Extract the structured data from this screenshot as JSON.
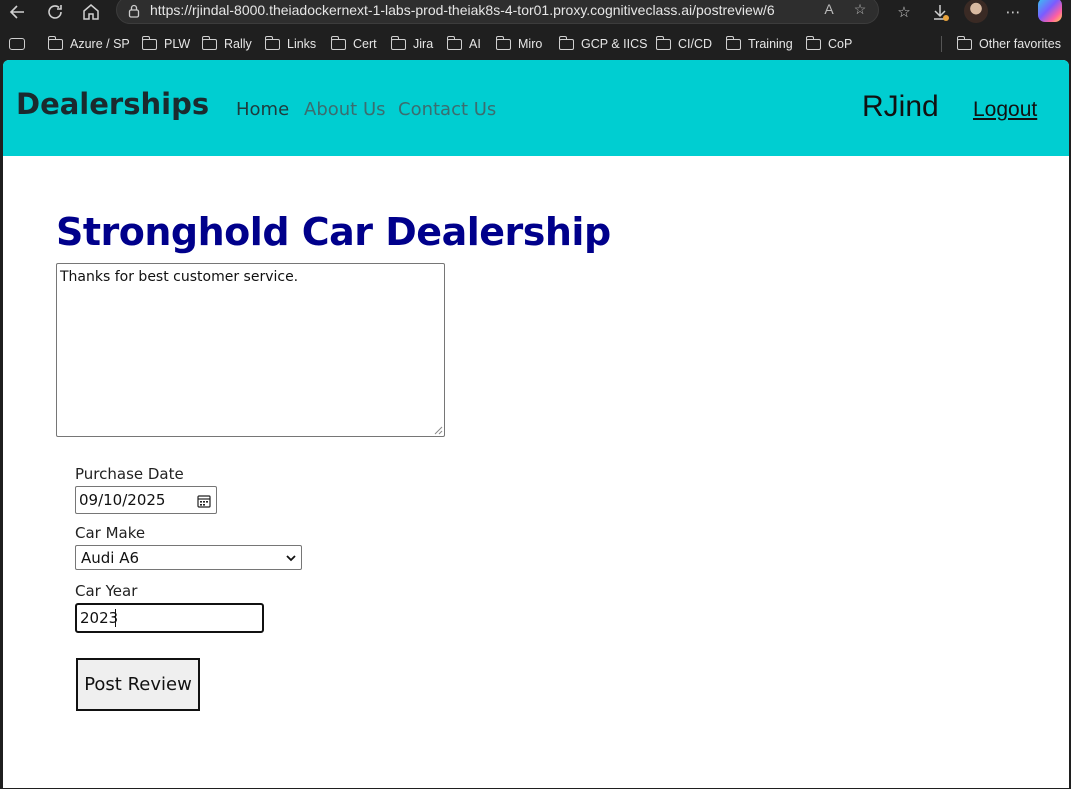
{
  "browser": {
    "url": "https://rjindal-8000.theiadockernext-1-labs-prod-theiak8s-4-tor01.proxy.cognitiveclass.ai/postreview/6",
    "bookmarks": [
      "Azure / SP",
      "PLW",
      "Rally",
      "Links",
      "Cert",
      "Jira",
      "AI",
      "Miro",
      "GCP & IICS",
      "CI/CD",
      "Training",
      "CoP"
    ],
    "other_favorites": "Other favorites"
  },
  "header": {
    "brand": "Dealerships",
    "nav": [
      "Home",
      "About Us",
      "Contact Us"
    ],
    "username": "RJind",
    "logout": "Logout",
    "background": "#00ced1"
  },
  "main": {
    "dealer_name": "Stronghold Car Dealership",
    "review_text": "Thanks for best customer service.",
    "purchase_date_label": "Purchase Date",
    "purchase_date": "09/10/2025",
    "car_make_label": "Car Make",
    "car_make": "Audi A6",
    "car_year_label": "Car Year",
    "car_year": "2023",
    "post_button": "Post Review",
    "title_color": "#00008b"
  },
  "icons": [
    "back-icon",
    "refresh-icon",
    "home-icon",
    "lock-icon",
    "read-aloud-icon",
    "favorite-star-icon",
    "favorites-icon",
    "downloads-icon",
    "more-icon",
    "calendar-icon",
    "chevron-down-icon"
  ]
}
